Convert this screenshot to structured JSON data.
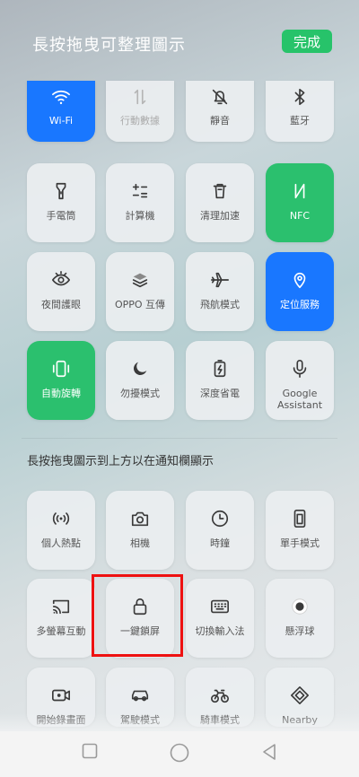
{
  "header": {
    "title": "長按拖曳可整理圖示",
    "done_label": "完成"
  },
  "active_tiles": [
    {
      "label": "Wi-Fi",
      "icon": "wifi-icon",
      "state": "on",
      "color": "#1977ff"
    },
    {
      "label": "行動數據",
      "icon": "mobile-data-icon",
      "state": "disabled"
    },
    {
      "label": "靜音",
      "icon": "bell-off-icon",
      "state": "off"
    },
    {
      "label": "藍牙",
      "icon": "bluetooth-icon",
      "state": "off"
    },
    {
      "label": "手電筒",
      "icon": "flashlight-icon",
      "state": "off"
    },
    {
      "label": "計算機",
      "icon": "calculator-icon",
      "state": "off"
    },
    {
      "label": "清理加速",
      "icon": "trash-icon",
      "state": "off"
    },
    {
      "label": "NFC",
      "icon": "nfc-icon",
      "state": "on",
      "color": "#2bc06e"
    },
    {
      "label": "夜間護眼",
      "icon": "eye-icon",
      "state": "off"
    },
    {
      "label": "OPPO 互傳",
      "icon": "oppo-share-icon",
      "state": "off"
    },
    {
      "label": "飛航模式",
      "icon": "airplane-icon",
      "state": "off"
    },
    {
      "label": "定位服務",
      "icon": "location-icon",
      "state": "on",
      "color": "#1977ff"
    },
    {
      "label": "自動旋轉",
      "icon": "rotate-icon",
      "state": "on",
      "color": "#2bc06e"
    },
    {
      "label": "勿擾模式",
      "icon": "moon-icon",
      "state": "off"
    },
    {
      "label": "深度省電",
      "icon": "battery-saver-icon",
      "state": "off"
    },
    {
      "label": "Google\nAssistant",
      "icon": "microphone-icon",
      "state": "off"
    }
  ],
  "section_label": "長按拖曳圖示到上方以在通知欄顯示",
  "available_tiles": [
    {
      "label": "個人熱點",
      "icon": "hotspot-icon"
    },
    {
      "label": "相機",
      "icon": "camera-icon"
    },
    {
      "label": "時鐘",
      "icon": "clock-icon"
    },
    {
      "label": "單手模式",
      "icon": "one-hand-icon"
    },
    {
      "label": "多螢幕互動",
      "icon": "cast-icon"
    },
    {
      "label": "一鍵鎖屏",
      "icon": "lock-icon",
      "highlighted": true
    },
    {
      "label": "切換輸入法",
      "icon": "keyboard-icon"
    },
    {
      "label": "懸浮球",
      "icon": "floating-ball-icon"
    },
    {
      "label": "開始錄畫面",
      "icon": "screen-record-icon"
    },
    {
      "label": "駕駛模式",
      "icon": "car-icon"
    },
    {
      "label": "騎車模式",
      "icon": "bicycle-icon"
    },
    {
      "label": "Nearby",
      "icon": "nearby-icon"
    }
  ],
  "highlight_color": "#e11111",
  "navbar": {
    "buttons": [
      "recent-apps-icon",
      "home-icon",
      "back-icon"
    ]
  }
}
